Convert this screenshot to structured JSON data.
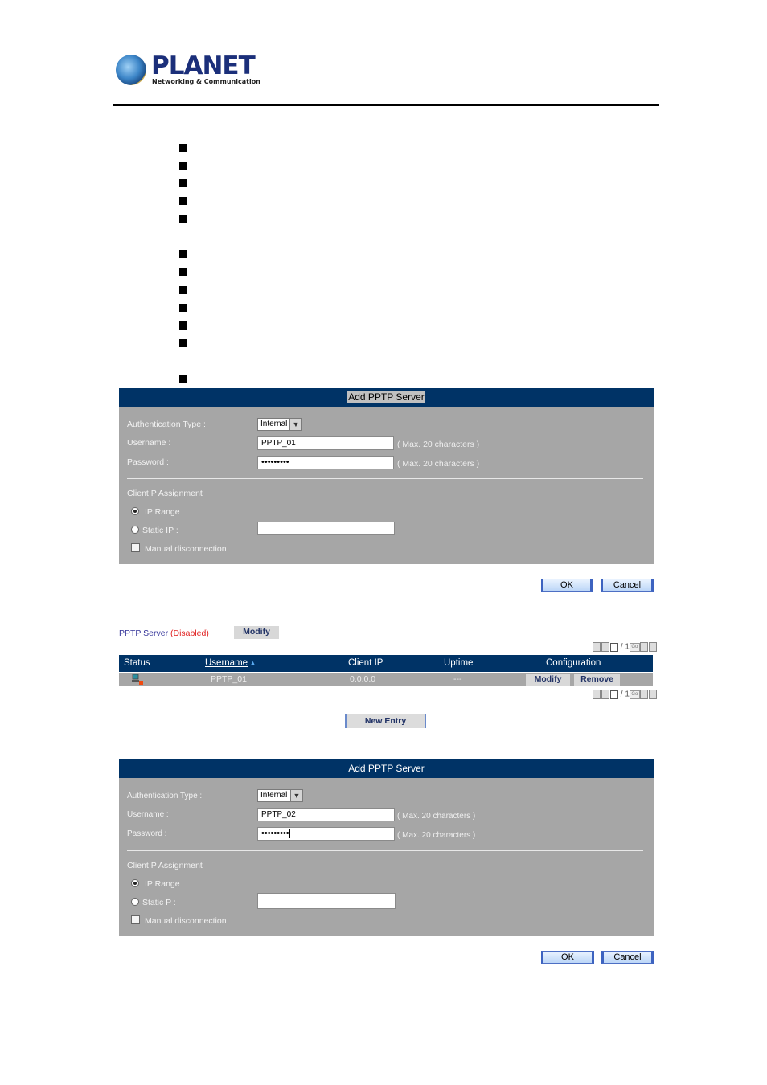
{
  "brand": {
    "name": "PLANET",
    "tagline": "Networking & Communication"
  },
  "bullets_count": 12,
  "form1": {
    "title": "Add PPTP Server",
    "auth_type_label": "Authentication Type :",
    "auth_type_value": "Internal",
    "username_label": "Username :",
    "username_value": "PPTP_01",
    "username_hint": "( Max. 20 characters )",
    "password_label": "Password :",
    "password_value": "•••••••••",
    "password_hint": "( Max. 20 characters )",
    "client_ip_label": "Client P Assignment",
    "ip_range_label": "IP Range",
    "ip_range_selected": true,
    "static_ip_label": "Static IP :",
    "static_ip_value": "",
    "manual_disconnect_label": "Manual disconnection",
    "manual_disconnect_checked": false,
    "ok_label": "OK",
    "cancel_label": "Cancel"
  },
  "server_list": {
    "title": "PPTP Server",
    "status_text": "(Disabled)",
    "modify_label": "Modify",
    "pager": {
      "current": "1",
      "total": "/ 1",
      "go": "Go"
    },
    "columns": [
      "Status",
      "Username",
      "Client IP",
      "Uptime",
      "Configuration"
    ],
    "sort_indicator": "▲",
    "rows": [
      {
        "status": "disconnected",
        "username": "PPTP_01",
        "client_ip": "0.0.0.0",
        "uptime": "---",
        "modify": "Modify",
        "remove": "Remove"
      }
    ],
    "new_entry_label": "New Entry"
  },
  "form2": {
    "title": "Add PPTP Server",
    "auth_type_label": "Authentication Type :",
    "auth_type_value": "Internal",
    "username_label": "Username :",
    "username_value": "PPTP_02",
    "username_hint": "( Max. 20 characters )",
    "password_label": "Password :",
    "password_value": "•••••••••",
    "password_hint": "( Max. 20 characters )",
    "client_ip_label": "Client P Assignment",
    "ip_range_label": "IP Range",
    "ip_range_selected": true,
    "static_ip_label": "Static P :",
    "static_ip_value": "",
    "manual_disconnect_label": "Manual disconnection",
    "manual_disconnect_checked": false,
    "ok_label": "OK",
    "cancel_label": "Cancel"
  }
}
